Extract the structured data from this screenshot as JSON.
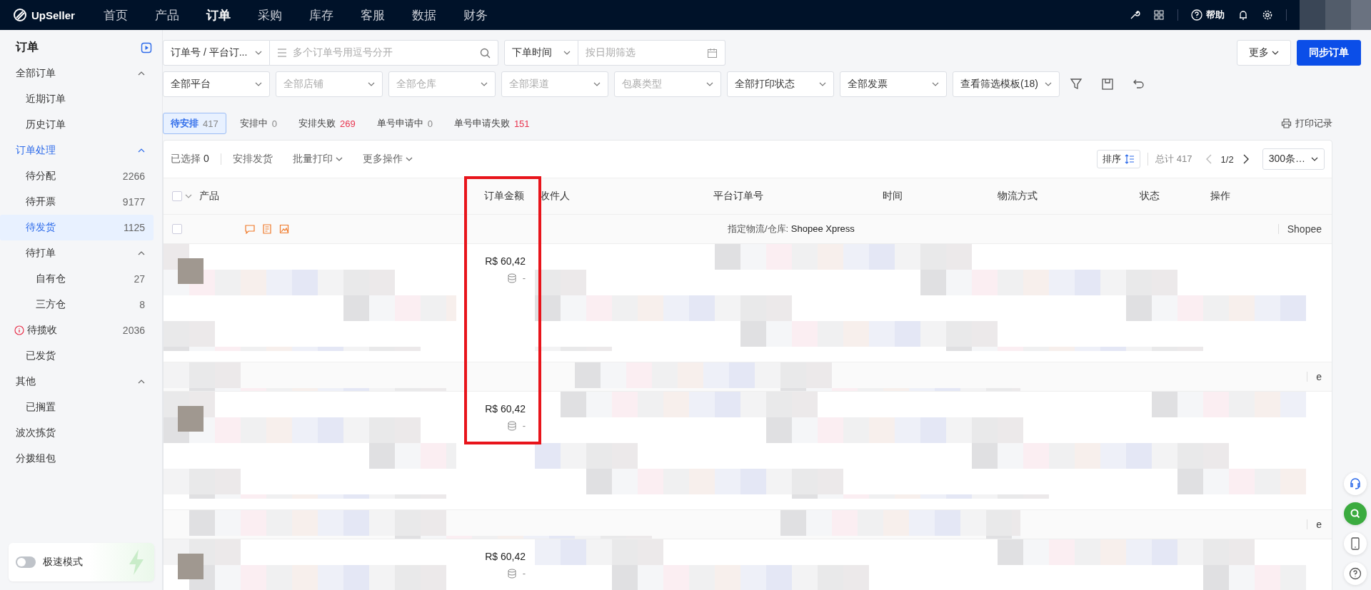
{
  "nav": {
    "logo": "UpSeller",
    "items": [
      {
        "label": "首页",
        "selected": false
      },
      {
        "label": "产品",
        "selected": false
      },
      {
        "label": "订单",
        "selected": true
      },
      {
        "label": "采购",
        "selected": false
      },
      {
        "label": "库存",
        "selected": false
      },
      {
        "label": "客服",
        "selected": false
      },
      {
        "label": "数据",
        "selected": false
      },
      {
        "label": "财务",
        "selected": false
      }
    ],
    "help": "帮助"
  },
  "sidebar": {
    "title": "订单",
    "sections": [
      {
        "label": "全部订单",
        "expanded": true,
        "selected": false,
        "children": [
          {
            "label": "近期订单",
            "selected": false
          },
          {
            "label": "历史订单",
            "selected": false
          }
        ]
      },
      {
        "label": "订单处理",
        "expanded": true,
        "selected": true,
        "children": [
          {
            "label": "待分配",
            "count": "2266",
            "selected": false
          },
          {
            "label": "待开票",
            "count": "9177",
            "selected": false
          },
          {
            "label": "待发货",
            "count": "1125",
            "selected": true
          },
          {
            "label": "待打单",
            "expanded": true,
            "selected": false,
            "children": [
              {
                "label": "自有仓",
                "count": "27",
                "selected": false
              },
              {
                "label": "三方仓",
                "count": "8",
                "selected": false
              }
            ]
          },
          {
            "label": "待揽收",
            "count": "2036",
            "alert": true,
            "selected": false
          },
          {
            "label": "已发货",
            "selected": false
          }
        ]
      },
      {
        "label": "其他",
        "expanded": true,
        "selected": false,
        "children": [
          {
            "label": "已搁置",
            "selected": false
          }
        ]
      },
      {
        "label": "波次拣货",
        "selected": false
      },
      {
        "label": "分拨组包",
        "selected": false
      }
    ],
    "speed_mode": {
      "label": "极速模式",
      "on": false
    }
  },
  "filters": {
    "search_type": "订单号 / 平台订...",
    "search_placeholder": "多个订单号用逗号分开",
    "time_type": "下单时间",
    "date_placeholder": "按日期筛选",
    "more": "更多",
    "sync": "同步订单",
    "selects": [
      {
        "value": "全部平台"
      },
      {
        "placeholder": "全部店铺"
      },
      {
        "placeholder": "全部仓库"
      },
      {
        "placeholder": "全部渠道"
      },
      {
        "placeholder": "包裹类型"
      },
      {
        "value": "全部打印状态"
      },
      {
        "value": "全部发票"
      },
      {
        "value": "查看筛选模板(18)"
      }
    ]
  },
  "status_tabs": [
    {
      "label": "待安排",
      "count": "417",
      "alert": false,
      "selected": true
    },
    {
      "label": "安排中",
      "count": "0",
      "alert": false,
      "selected": false
    },
    {
      "label": "安排失败",
      "count": "269",
      "alert": true,
      "selected": false
    },
    {
      "label": "单号申请中",
      "count": "0",
      "alert": false,
      "selected": false
    },
    {
      "label": "单号申请失败",
      "count": "151",
      "alert": true,
      "selected": false
    }
  ],
  "print_record": "打印记录",
  "toolbar": {
    "selected_label": "已选择",
    "selected_count": "0",
    "actions": [
      {
        "label": "安排发货",
        "dropdown": false
      },
      {
        "label": "批量打印",
        "dropdown": true
      },
      {
        "label": "更多操作",
        "dropdown": true
      }
    ],
    "sort": "排序",
    "total": "总计 417",
    "page": "1/2",
    "page_size": "300条…"
  },
  "table": {
    "select_all_checked": false,
    "columns": [
      "产品",
      "订单金额",
      "收件人",
      "平台订单号",
      "时间",
      "物流方式",
      "状态",
      "操作"
    ],
    "groups": [
      {
        "checked": false,
        "logistics_label": "指定物流/仓库:",
        "logistics_value": "Shopee Xpress",
        "platform": "Shopee",
        "orders": [
          {
            "amount": "R$ 60,42",
            "cost": "-"
          }
        ]
      },
      {
        "platform": "e",
        "orders": [
          {
            "amount": "R$ 60,42",
            "cost": "-"
          }
        ]
      },
      {
        "platform": "e",
        "orders": [
          {
            "amount": "R$ 60,42",
            "cost": "-"
          }
        ]
      }
    ]
  }
}
